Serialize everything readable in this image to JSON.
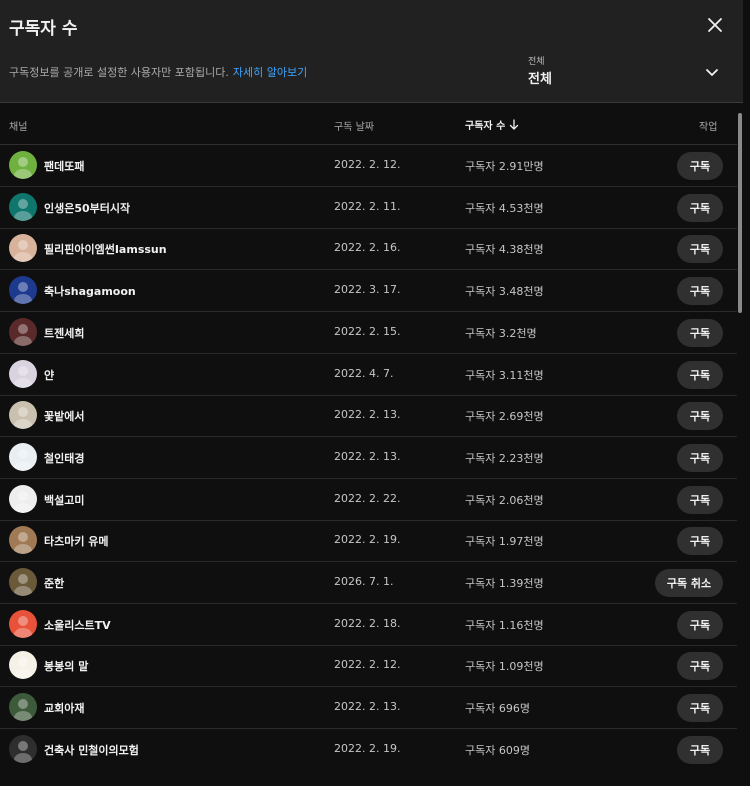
{
  "dialog": {
    "title": "구독자 수",
    "subtitle": "구독정보를 공개로 설정한 사용자만 포함됩니다.",
    "learn_more": "자세히 알아보기",
    "filter_label": "전체",
    "filter_value": "전체"
  },
  "table": {
    "headers": {
      "channel": "채널",
      "date": "구독 날짜",
      "subs": "구독자 수",
      "action": "작업"
    },
    "rows": [
      {
        "name": "팬데또패",
        "date": "2022. 2. 12.",
        "subs": "구독자 2.91만명",
        "button": "구독"
      },
      {
        "name": "인생은50부터시작",
        "date": "2022. 2. 11.",
        "subs": "구독자 4.53천명",
        "button": "구독"
      },
      {
        "name": "필리핀아이엠썬Iamssun",
        "date": "2022. 2. 16.",
        "subs": "구독자 4.38천명",
        "button": "구독"
      },
      {
        "name": "축나shagamoon",
        "date": "2022. 3. 17.",
        "subs": "구독자 3.48천명",
        "button": "구독"
      },
      {
        "name": "트젠세희",
        "date": "2022. 2. 15.",
        "subs": "구독자 3.2천명",
        "button": "구독"
      },
      {
        "name": "얀",
        "date": "2022. 4. 7.",
        "subs": "구독자 3.11천명",
        "button": "구독"
      },
      {
        "name": "꽃밭에서",
        "date": "2022. 2. 13.",
        "subs": "구독자 2.69천명",
        "button": "구독"
      },
      {
        "name": "철인태경",
        "date": "2022. 2. 13.",
        "subs": "구독자 2.23천명",
        "button": "구독"
      },
      {
        "name": "백설고미",
        "date": "2022. 2. 22.",
        "subs": "구독자 2.06천명",
        "button": "구독"
      },
      {
        "name": "타츠마키 유메",
        "date": "2022. 2. 19.",
        "subs": "구독자 1.97천명",
        "button": "구독"
      },
      {
        "name": "준한",
        "date": "2026. 7. 1.",
        "subs": "구독자 1.39천명",
        "button": "구독 취소"
      },
      {
        "name": "소울리스트TV",
        "date": "2022. 2. 18.",
        "subs": "구독자 1.16천명",
        "button": "구독"
      },
      {
        "name": "봉봉의 말",
        "date": "2022. 2. 12.",
        "subs": "구독자 1.09천명",
        "button": "구독"
      },
      {
        "name": "교회아재",
        "date": "2022. 2. 13.",
        "subs": "구독자 696명",
        "button": "구독"
      },
      {
        "name": "건축사 민철이의모험",
        "date": "2022. 2. 19.",
        "subs": "구독자 609명",
        "button": "구독"
      }
    ],
    "avatar_colors": [
      "#6fb13f",
      "#0f766e",
      "#d8b29a",
      "#1d3a8f",
      "#5a2a2a",
      "#d9d3e0",
      "#c9c0b0",
      "#e8eef2",
      "#eeeeee",
      "#a07a55",
      "#6b5a3a",
      "#e8523a",
      "#f5f1e6",
      "#3d5a3a",
      "#2e2e2e"
    ]
  },
  "icons": {
    "close": "close-icon",
    "chevron": "chevron-down-icon",
    "sort": "arrow-down-icon"
  }
}
